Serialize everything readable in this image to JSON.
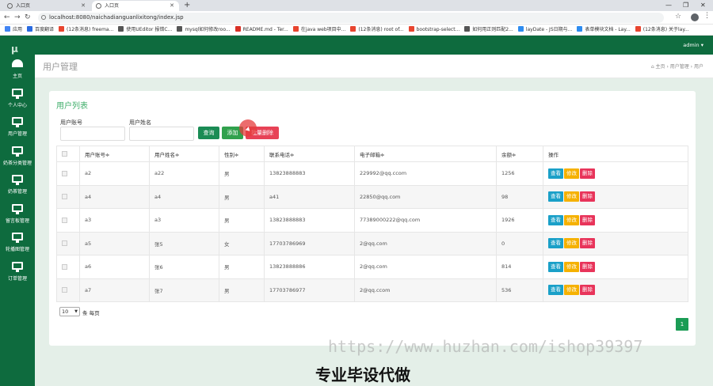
{
  "browser": {
    "tabs": [
      {
        "label": "入口页"
      },
      {
        "label": "入口页"
      }
    ],
    "url": "localhost:8080/naichadianguanlixitong/index.jsp",
    "bookmarks": [
      {
        "label": "应用",
        "color": "#4285f4"
      },
      {
        "label": "百度翻译",
        "color": "#2a6be0"
      },
      {
        "label": "(12条消息) freema...",
        "color": "#e8452f"
      },
      {
        "label": "使用UEditor 报错C...",
        "color": "#555555"
      },
      {
        "label": "mysql如何修改roo...",
        "color": "#555555"
      },
      {
        "label": "README.md - Ter...",
        "color": "#d93025"
      },
      {
        "label": "在java web项目中...",
        "color": "#e8452f"
      },
      {
        "label": "(12条消息) root of...",
        "color": "#e8452f"
      },
      {
        "label": "bootstrap-select...",
        "color": "#e8452f"
      },
      {
        "label": "如何用正则匹配2...",
        "color": "#555555"
      },
      {
        "label": "layDate - JS日期与...",
        "color": "#2d8cf0"
      },
      {
        "label": "表单模块文档 - Lay...",
        "color": "#2d8cf0"
      },
      {
        "label": "(12条消息) 关于lay...",
        "color": "#e8452f"
      }
    ]
  },
  "sidebar": {
    "logo": "μ",
    "items": [
      {
        "label": "主页",
        "icon": "dashboard-icon"
      },
      {
        "label": "个人中心",
        "icon": "monitor-icon"
      },
      {
        "label": "用户管理",
        "icon": "monitor-icon"
      },
      {
        "label": "奶茶分类管理",
        "icon": "monitor-icon"
      },
      {
        "label": "奶茶管理",
        "icon": "monitor-icon"
      },
      {
        "label": "留言板管理",
        "icon": "monitor-icon"
      },
      {
        "label": "轮播图管理",
        "icon": "monitor-icon"
      },
      {
        "label": "订单管理",
        "icon": "monitor-icon"
      }
    ]
  },
  "topbar": {
    "user": "admin ▾"
  },
  "page": {
    "title": "用户管理",
    "breadcrumb": "⌂ 主页  ›  用户管理  ›  用户"
  },
  "panel": {
    "title": "用户列表",
    "filters": {
      "account_label": "用户账号",
      "name_label": "用户姓名"
    },
    "buttons": {
      "search": "查询",
      "add": "添加",
      "bulk_delete": "批量删除"
    },
    "columns": [
      "用户账号≑",
      "用户姓名≑",
      "性别≑",
      "联系电话≑",
      "电子邮箱≑",
      "余额≑",
      "操作"
    ],
    "rows": [
      {
        "account": "a2",
        "name": "a22",
        "gender": "男",
        "phone": "13823888883",
        "email": "229992@qq.ccom",
        "balance": "1256"
      },
      {
        "account": "a4",
        "name": "a4",
        "gender": "男",
        "phone": "a41",
        "email": "22850@qq.com",
        "balance": "98"
      },
      {
        "account": "a3",
        "name": "a3",
        "gender": "男",
        "phone": "13823888883",
        "email": "77389000222@qq.com",
        "balance": "1926"
      },
      {
        "account": "a5",
        "name": "张5",
        "gender": "女",
        "phone": "17703786969",
        "email": "2@qq.com",
        "balance": "0"
      },
      {
        "account": "a6",
        "name": "张6",
        "gender": "男",
        "phone": "13823888886",
        "email": "2@qq.com",
        "balance": "814"
      },
      {
        "account": "a7",
        "name": "张7",
        "gender": "男",
        "phone": "17703786977",
        "email": "2@qq.ccom",
        "balance": "536"
      }
    ],
    "row_actions": {
      "view": "查看",
      "edit": "修改",
      "delete": "删除"
    },
    "page_size": "10",
    "per_page_label": "条 每页",
    "current_page": "1"
  },
  "overlay": {
    "watermark": "https://www.huzhan.com/ishop39397",
    "caption": "专业毕设代做"
  }
}
